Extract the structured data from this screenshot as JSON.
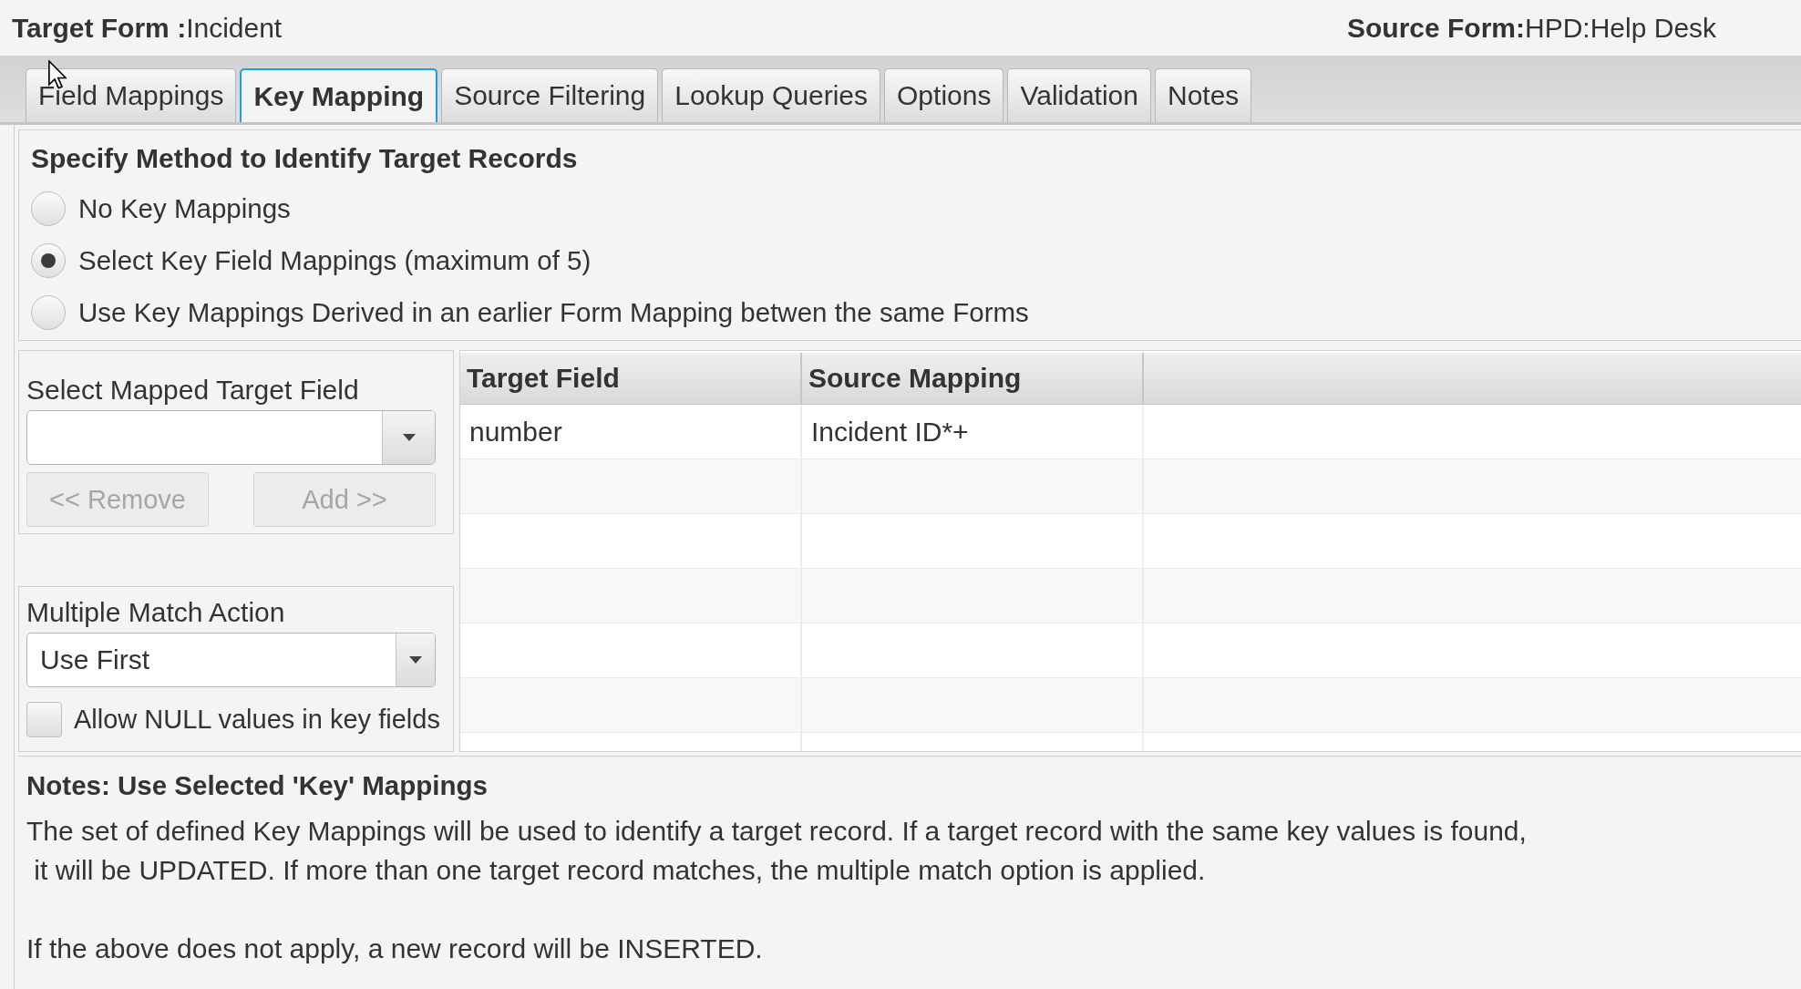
{
  "header": {
    "target_form": "**Target Form :**Incident",
    "source_form": "**Source Form:**HPD:Help Desk"
  },
  "tabs": [
    {
      "label": "Field Mappings",
      "selected": false
    },
    {
      "label": "Key Mapping",
      "selected": true
    },
    {
      "label": "Source Filtering",
      "selected": false
    },
    {
      "label": "Lookup Queries",
      "selected": false
    },
    {
      "label": "Options",
      "selected": false
    },
    {
      "label": "Validation",
      "selected": false
    },
    {
      "label": "Notes",
      "selected": false
    }
  ],
  "method_section": {
    "title": "Specify Method to Identify Target Records",
    "options": [
      {
        "label": "No Key Mappings",
        "selected": false
      },
      {
        "label": "Select Key Field Mappings (maximum of 5)",
        "selected": true
      },
      {
        "label": "Use Key Mappings Derived in an earlier Form Mapping betwen the same Forms",
        "selected": false
      }
    ]
  },
  "target_field_panel": {
    "label": "Select Mapped Target Field",
    "buttons": [
      {
        "label": "<< Remove",
        "disabled": true
      },
      {
        "label": "Add >>",
        "disabled": true
      }
    ]
  },
  "match_panel": {
    "label": "Multiple Match Action",
    "value": "Use First",
    "allow_null": {
      "label": "Allow NULL values in key fields",
      "checked": false
    }
  },
  "table": {
    "columns": [
      "Target Field",
      "Source Mapping"
    ],
    "rows": [
      {
        "cells": [
          "number",
          "Incident ID*+"
        ]
      }
    ]
  },
  "notes": {
    "title": "Notes: Use Selected 'Key' Mappings",
    "paragraphs": [
      "The set of defined Key Mappings will be used to identify a target record. If a target record with the same key values is found,\n it will be UPDATED. If more than one target record matches, the multiple match option is applied.",
      "If the above does not apply, a new record will be INSERTED."
    ]
  }
}
